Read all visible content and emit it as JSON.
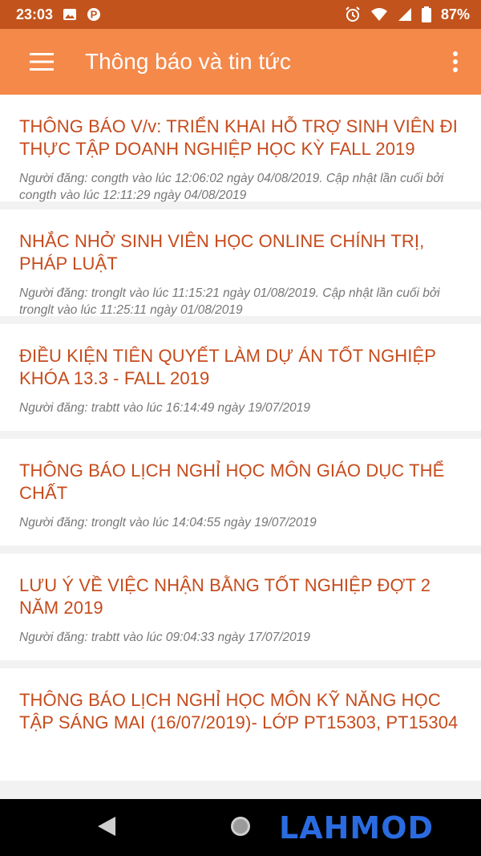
{
  "status_bar": {
    "time": "23:03",
    "battery": "87%"
  },
  "app_bar": {
    "title": "Thông báo và tin tức"
  },
  "notices": [
    {
      "title": "THÔNG BÁO V/v: TRIỂN KHAI HỖ TRỢ SINH VIÊN ĐI THỰC TẬP DOANH NGHIỆP HỌC KỲ FALL 2019",
      "meta": "Người đăng: congth vào lúc 12:06:02 ngày 04/08/2019. Cập nhật lần cuối bởi congth vào lúc 12:11:29 ngày 04/08/2019"
    },
    {
      "title": "NHẮC NHỞ SINH VIÊN HỌC ONLINE CHÍNH TRỊ, PHÁP LUẬT",
      "meta": "Người đăng: tronglt vào lúc 11:15:21 ngày 01/08/2019. Cập nhật lần cuối bởi tronglt vào lúc 11:25:11 ngày 01/08/2019"
    },
    {
      "title": "ĐIỀU KIỆN TIÊN QUYẾT LÀM DỰ ÁN TỐT NGHIỆP KHÓA 13.3 - FALL 2019",
      "meta": "Người đăng: trabtt vào lúc 16:14:49 ngày 19/07/2019"
    },
    {
      "title": "THÔNG BÁO LỊCH NGHỈ HỌC MÔN GIÁO DỤC THỂ CHẤT",
      "meta": "Người đăng: tronglt vào lúc 14:04:55 ngày 19/07/2019"
    },
    {
      "title": "LƯU Ý VỀ VIỆC NHẬN BẰNG TỐT NGHIỆP ĐỢT 2 NĂM 2019",
      "meta": "Người đăng: trabtt vào lúc 09:04:33 ngày 17/07/2019"
    },
    {
      "title": "THÔNG BÁO LỊCH NGHỈ HỌC MÔN KỸ NĂNG HỌC TẬP SÁNG MAI (16/07/2019)- LỚP PT15303, PT15304",
      "meta": ""
    }
  ],
  "watermark": "LAHMOD",
  "colors": {
    "status_bar": "#c2531c",
    "app_bar": "#f4894a",
    "notice_title": "#c64b1c"
  }
}
